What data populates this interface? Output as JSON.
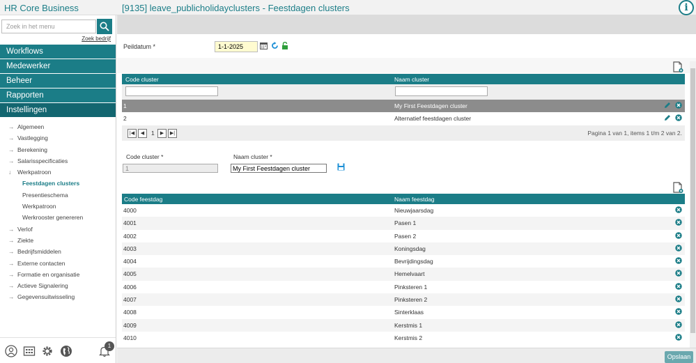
{
  "header": {
    "app_title": "HR Core Business",
    "page_title": "[9135] leave_publicholidayclusters - Feestdagen clusters"
  },
  "sidebar": {
    "search_placeholder": "Zoek in het menu",
    "search_company": "Zoek bedrijf",
    "main_items": [
      {
        "label": "Workflows"
      },
      {
        "label": "Medewerker"
      },
      {
        "label": "Beheer"
      },
      {
        "label": "Rapporten"
      },
      {
        "label": "Instellingen"
      }
    ],
    "sub_items": [
      {
        "label": "Algemeen"
      },
      {
        "label": "Vastlegging"
      },
      {
        "label": "Berekening"
      },
      {
        "label": "Salarisspecificaties"
      },
      {
        "label": "Werkpatroon"
      },
      {
        "label": "Feestdagen clusters"
      },
      {
        "label": "Presentieschema"
      },
      {
        "label": "Werkpatroon"
      },
      {
        "label": "Werkrooster genereren"
      },
      {
        "label": "Verlof"
      },
      {
        "label": "Ziekte"
      },
      {
        "label": "Bedrijfsmiddelen"
      },
      {
        "label": "Externe contacten"
      },
      {
        "label": "Formatie en organisatie"
      },
      {
        "label": "Actieve Signalering"
      },
      {
        "label": "Gegevensuitwisseling"
      }
    ],
    "notification_count": "1"
  },
  "peildatum": {
    "label": "Peildatum *",
    "value": "1-1-2025"
  },
  "clusters_table": {
    "col_code": "Code cluster",
    "col_name": "Naam cluster",
    "rows": [
      {
        "code": "1",
        "name": "My First Feestdagen cluster"
      },
      {
        "code": "2",
        "name": "Alternatief feestdagen cluster"
      }
    ],
    "page_number": "1",
    "page_info": "Pagina 1 van 1, items 1 t/m 2 van 2."
  },
  "detail_form": {
    "code_label": "Code cluster *",
    "code_value": "1",
    "name_label": "Naam cluster *",
    "name_value": "My First Feestdagen cluster"
  },
  "holidays_table": {
    "col_code": "Code feestdag",
    "col_name": "Naam feestdag",
    "rows": [
      {
        "code": "4000",
        "name": "Nieuwjaarsdag"
      },
      {
        "code": "4001",
        "name": "Pasen 1"
      },
      {
        "code": "4002",
        "name": "Pasen 2"
      },
      {
        "code": "4003",
        "name": "Koningsdag"
      },
      {
        "code": "4004",
        "name": "Bevrijdingsdag"
      },
      {
        "code": "4005",
        "name": "Hemelvaart"
      },
      {
        "code": "4006",
        "name": "Pinksteren 1"
      },
      {
        "code": "4007",
        "name": "Pinksteren 2"
      },
      {
        "code": "4008",
        "name": "Sinterklaas"
      },
      {
        "code": "4009",
        "name": "Kerstmis 1"
      },
      {
        "code": "4010",
        "name": "Kerstmis 2"
      }
    ]
  },
  "footer": {
    "save_label": "Opslaan"
  },
  "colors": {
    "accent": "#1b7d87",
    "selected_row": "#8c8c8c"
  }
}
